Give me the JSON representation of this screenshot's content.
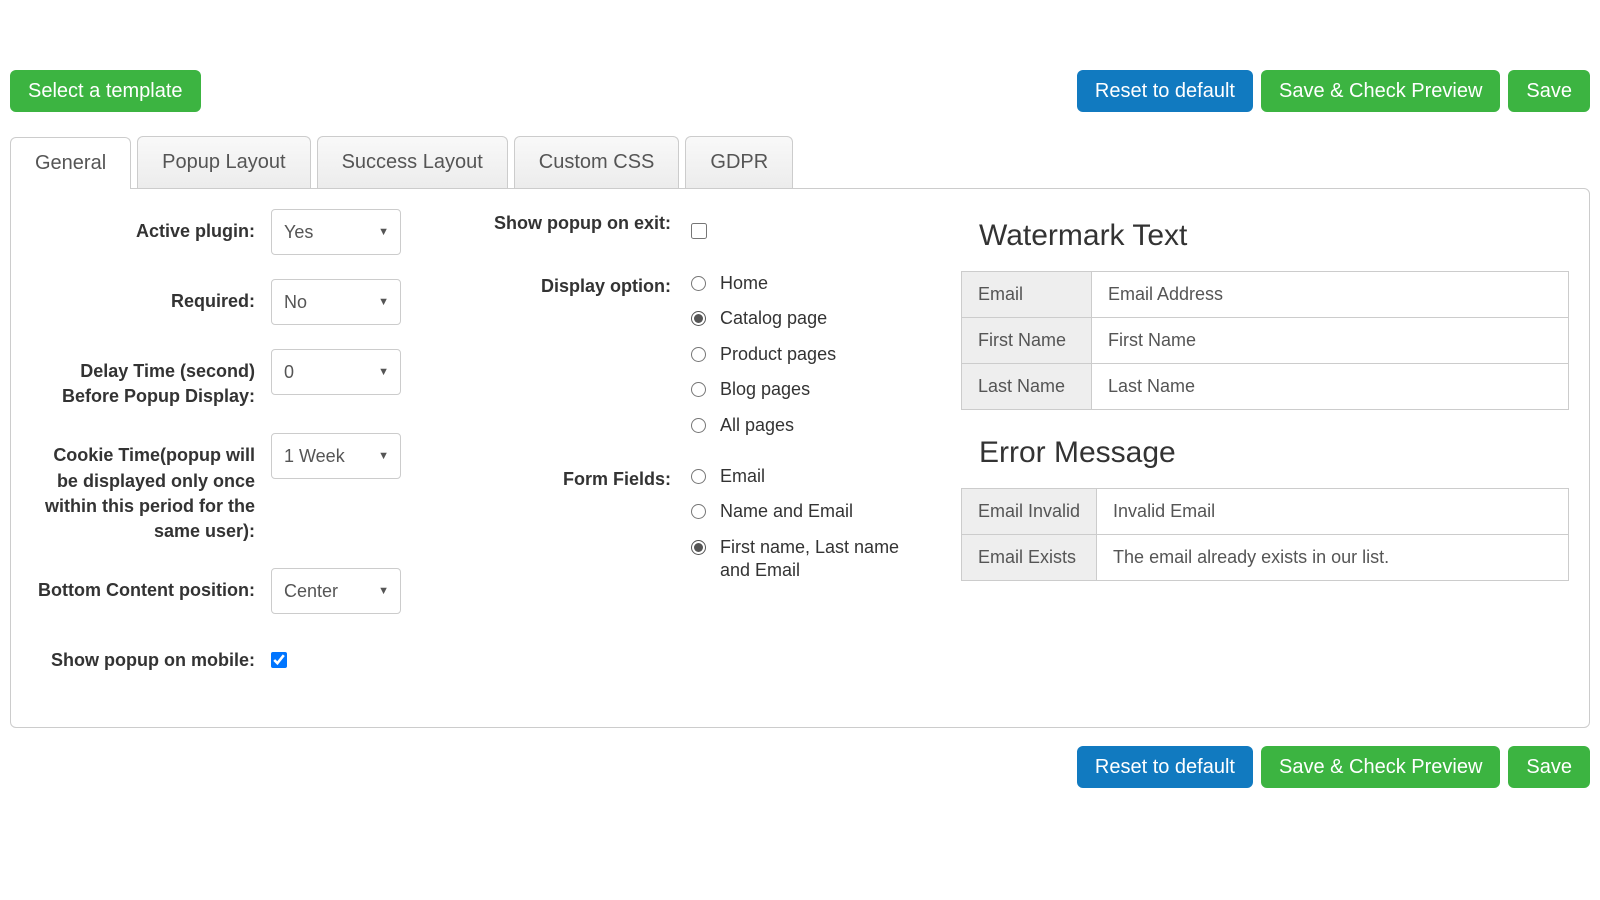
{
  "toolbar": {
    "select_template": "Select a template",
    "reset": "Reset to default",
    "save_preview": "Save & Check Preview",
    "save": "Save"
  },
  "tabs": {
    "general": "General",
    "popup_layout": "Popup Layout",
    "success_layout": "Success Layout",
    "custom_css": "Custom CSS",
    "gdpr": "GDPR"
  },
  "left": {
    "active_plugin_label": "Active plugin:",
    "active_plugin_value": "Yes",
    "required_label": "Required:",
    "required_value": "No",
    "delay_label": "Delay Time (second) Before Popup Display:",
    "delay_value": "0",
    "cookie_label": "Cookie Time(popup will be displayed only once within this period for the same user):",
    "cookie_value": "1 Week",
    "bottom_label": "Bottom Content position:",
    "bottom_value": "Center",
    "mobile_label": "Show popup on mobile:",
    "mobile_checked": true
  },
  "mid": {
    "exit_label": "Show popup on exit:",
    "exit_checked": false,
    "display_label": "Display option:",
    "display_options": [
      "Home",
      "Catalog page",
      "Product pages",
      "Blog pages",
      "All pages"
    ],
    "display_selected": "Catalog page",
    "form_fields_label": "Form Fields:",
    "form_fields_options": [
      "Email",
      "Name and Email",
      "First name, Last name and Email"
    ],
    "form_fields_selected": "First name, Last name and Email"
  },
  "right": {
    "watermark_heading": "Watermark Text",
    "watermark_rows": [
      {
        "k": "Email",
        "v": "Email Address"
      },
      {
        "k": "First Name",
        "v": "First Name"
      },
      {
        "k": "Last Name",
        "v": "Last Name"
      }
    ],
    "error_heading": "Error Message",
    "error_rows": [
      {
        "k": "Email Invalid",
        "v": "Invalid Email"
      },
      {
        "k": "Email Exists",
        "v": "The email already exists in our list."
      }
    ]
  }
}
